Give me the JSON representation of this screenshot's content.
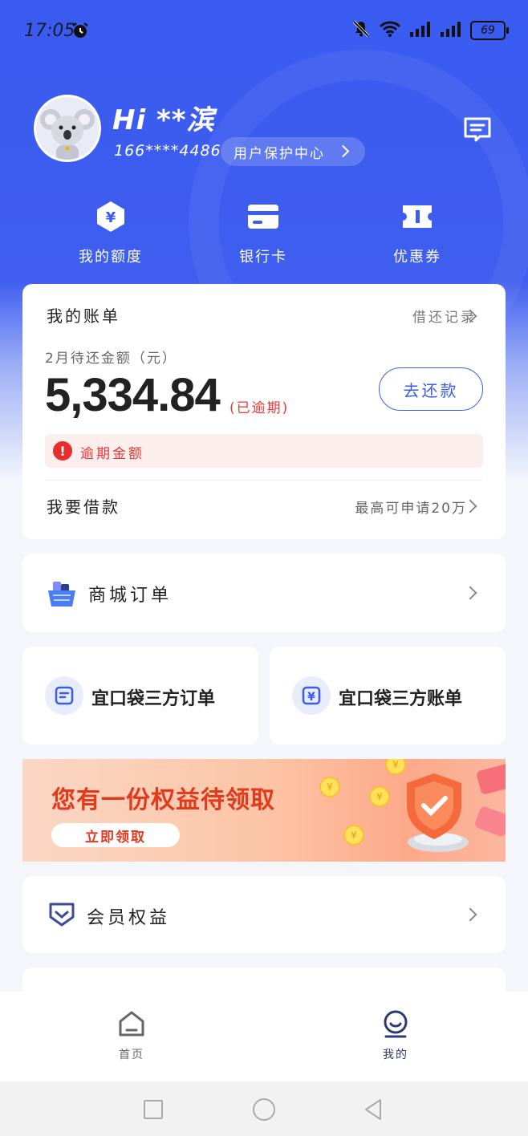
{
  "status_bar": {
    "time": "17:05",
    "battery": "69"
  },
  "profile": {
    "greeting": "Hi **滨",
    "phone": "166****4486",
    "protection_center": "用户保护中心"
  },
  "quick_actions": [
    {
      "label": "我的额度",
      "icon": "yuan-shield-icon"
    },
    {
      "label": "银行卡",
      "icon": "bank-card-icon"
    },
    {
      "label": "优惠券",
      "icon": "coupon-icon"
    }
  ],
  "bill": {
    "title": "我的账单",
    "record_link": "借还记录",
    "due_label": "2月待还金额（元）",
    "amount": "5,334.84",
    "status": "(已逾期)",
    "repay_button": "去还款",
    "overdue_notice": "逾期金额",
    "borrow_label": "我要借款",
    "borrow_hint": "最高可申请20万"
  },
  "mall_orders": {
    "label": "商城订单"
  },
  "third_party": {
    "orders": "宜口袋三方订单",
    "bills": "宜口袋三方账单"
  },
  "banner": {
    "title": "您有一份权益待领取",
    "button": "立即领取"
  },
  "membership": {
    "label": "会员权益"
  },
  "tabbar": {
    "home": "首页",
    "mine": "我的"
  },
  "colors": {
    "brand_blue": "#3a5bf0",
    "alert_red": "#e53935"
  }
}
